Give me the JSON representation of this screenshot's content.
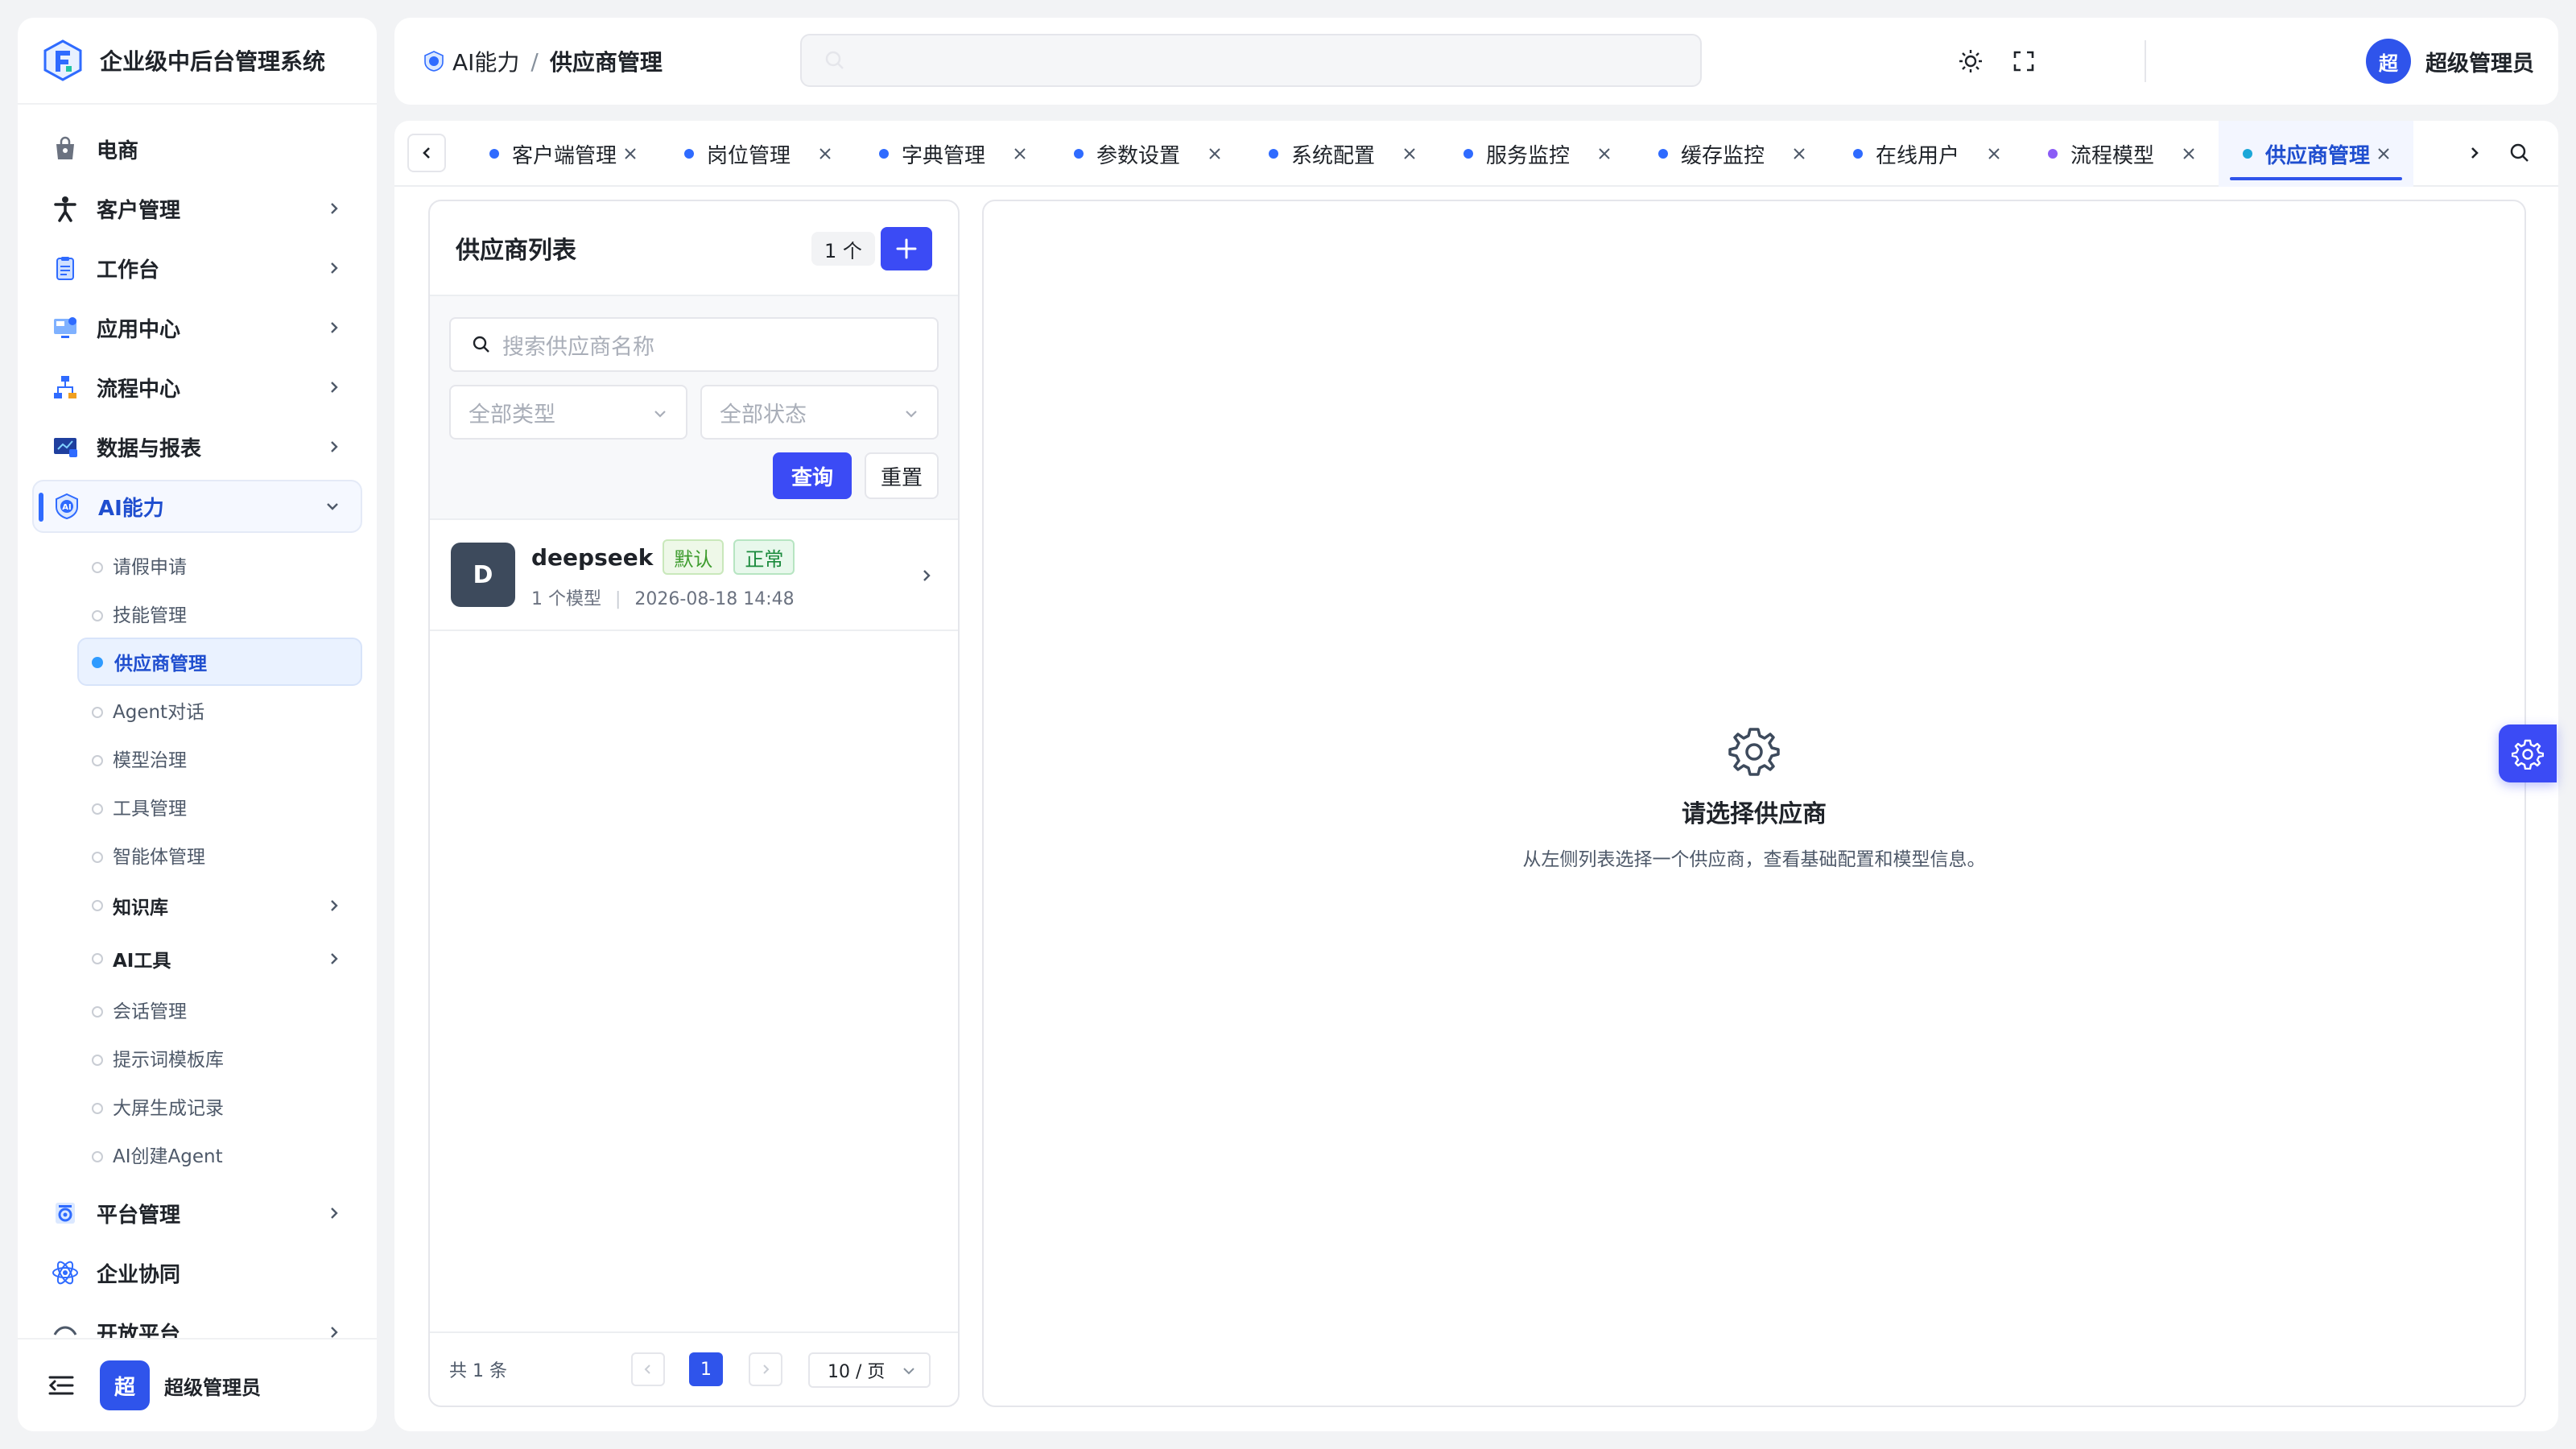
{
  "app": {
    "title": "企业级中后台管理系统"
  },
  "sidebar": {
    "items": [
      {
        "label": "电商",
        "icon": "bag-icon"
      },
      {
        "label": "客户管理",
        "icon": "person-icon"
      },
      {
        "label": "工作台",
        "icon": "clipboard-icon"
      },
      {
        "label": "应用中心",
        "icon": "monitor-icon"
      },
      {
        "label": "流程中心",
        "icon": "flow-icon"
      },
      {
        "label": "数据与报表",
        "icon": "chart-icon"
      },
      {
        "label": "AI能力",
        "icon": "ai-shield-icon"
      }
    ],
    "ai_sub": [
      "请假申请",
      "技能管理",
      "供应商管理",
      "Agent对话",
      "模型治理",
      "工具管理",
      "智能体管理"
    ],
    "ai_sub_parents": [
      "知识库",
      "AI工具"
    ],
    "ai_sub_more": [
      "会话管理",
      "提示词模板库",
      "大屏生成记录",
      "AI创建Agent"
    ],
    "bottom_items": [
      {
        "label": "平台管理",
        "icon": "gear-badge-icon"
      },
      {
        "label": "企业协同",
        "icon": "atom-icon"
      },
      {
        "label": "开放平台",
        "icon": "open-icon"
      }
    ],
    "footer": {
      "avatar": "超",
      "name": "超级管理员"
    }
  },
  "header": {
    "breadcrumb": [
      "AI能力",
      "/",
      "供应商管理"
    ],
    "user": {
      "avatar": "超",
      "name": "超级管理员"
    }
  },
  "tabs": [
    "客户端管理",
    "岗位管理",
    "字典管理",
    "参数设置",
    "系统配置",
    "服务监控",
    "缓存监控",
    "在线用户",
    "流程模型",
    "供应商管理"
  ],
  "tab_dot_colors": [
    "#2f6bff",
    "#2f6bff",
    "#2f6bff",
    "#2f6bff",
    "#2f6bff",
    "#2f6bff",
    "#2f6bff",
    "#2f6bff",
    "#8b5cf6",
    "#1ba7d8"
  ],
  "provider_panel": {
    "title": "供应商列表",
    "count": "1 个",
    "search_placeholder": "搜索供应商名称",
    "type_select": "全部类型",
    "status_select": "全部状态",
    "query_btn": "查询",
    "reset_btn": "重置",
    "providers": [
      {
        "avatar": "D",
        "name": "deepseek",
        "tag_default": "默认",
        "tag_status": "正常",
        "models": "1 个模型",
        "sep": "|",
        "time": "2026-08-18 14:48"
      }
    ],
    "pagination": {
      "total": "共 1 条",
      "current": "1",
      "page_size": "10 / 页"
    }
  },
  "detail_panel": {
    "empty_title": "请选择供应商",
    "empty_desc": "从左侧列表选择一个供应商，查看基础配置和模型信息。"
  },
  "colors": {
    "primary": "#3b4bf5",
    "accent": "#2f54eb",
    "success": "#1a8a3c"
  }
}
